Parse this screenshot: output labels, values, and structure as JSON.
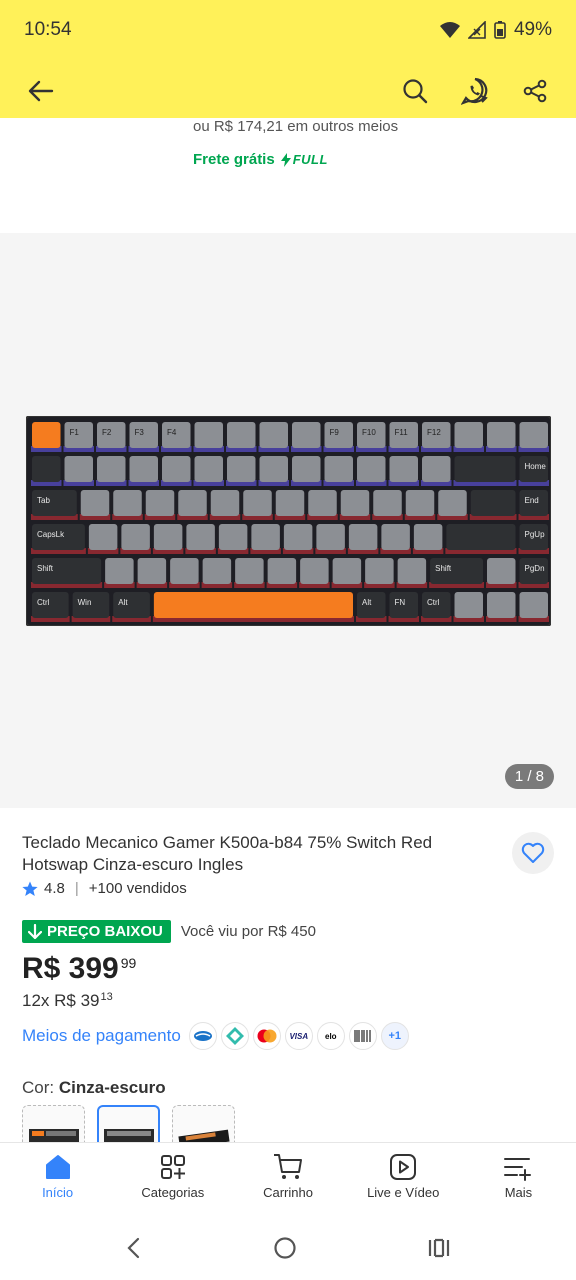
{
  "status": {
    "time": "10:54",
    "battery": "49%"
  },
  "top": {
    "other_payment": "ou R$ 174,21 em outros meios",
    "shipping": "Frete grátis",
    "full": "FULL"
  },
  "gallery": {
    "counter": "1 / 8"
  },
  "product": {
    "title": "Teclado Mecanico Gamer K500a-b84 75% Switch Red Hotswap Cinza-escuro Ingles",
    "rating": "4.8",
    "sold": "+100 vendidos",
    "badge": "PREÇO BAIXOU",
    "seen": "Você viu por R$ 450",
    "price_main": "R$ 399",
    "price_cents": "99",
    "installment_main": "12x R$ 39",
    "installment_cents": "13",
    "payments_label": "Meios de pagamento",
    "payment_icons": [
      "debit-card",
      "pix",
      "mastercard",
      "visa",
      "elo",
      "boleto"
    ],
    "payment_more": "+1",
    "color_label": "Cor:",
    "color_value": "Cinza-escuro"
  },
  "keyboard_labels": {
    "f1": "F1",
    "f2": "F2",
    "f3": "F3",
    "f4": "F4",
    "f9": "F9",
    "f10": "F10",
    "f11": "F11",
    "f12": "F12",
    "home": "Home",
    "tab": "Tab",
    "end": "End",
    "caps": "CapsLk",
    "pgup": "PgUp",
    "shift": "Shift",
    "shift_r": "Shift",
    "pgdn": "PgDn",
    "ctrl": "Ctrl",
    "win": "Win",
    "alt": "Alt",
    "alt_r": "Alt",
    "fn": "FN",
    "ctrl_r": "Ctrl"
  },
  "nav": {
    "inicio": "Início",
    "categorias": "Categorias",
    "carrinho": "Carrinho",
    "live": "Live e Vídeo",
    "mais": "Mais"
  },
  "colors": {
    "yellow": "#fff159",
    "blue": "#3483fa",
    "green": "#00a650",
    "orange": "#f57c1f"
  }
}
